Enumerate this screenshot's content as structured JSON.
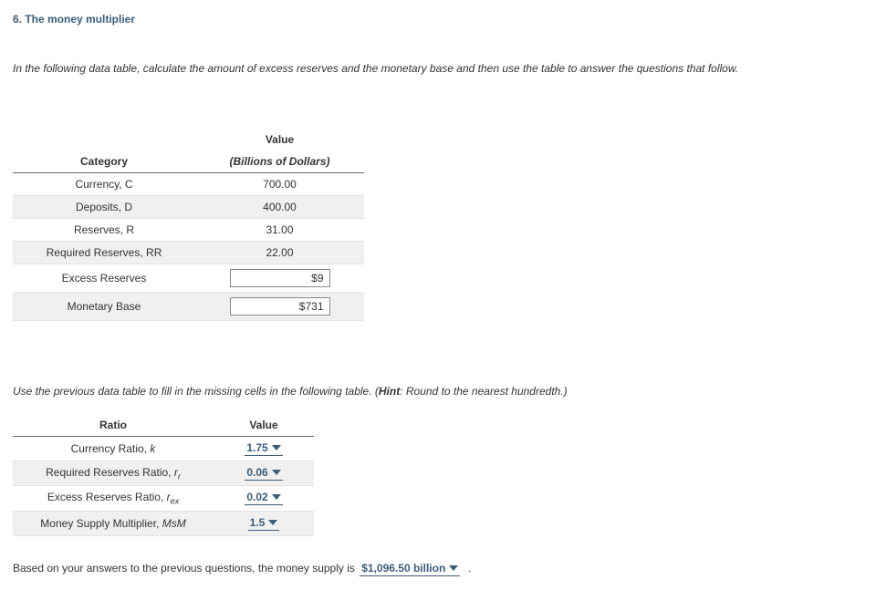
{
  "title": "6. The money multiplier",
  "intro": "In the following data table, calculate the amount of excess reserves and the monetary base and then use the table to answer the questions that follow.",
  "table1": {
    "catHeader": "Category",
    "valHeader": "Value",
    "valSubheader": "(Billions of Dollars)",
    "rows": {
      "currency": {
        "label": "Currency, C",
        "value": "700.00"
      },
      "deposits": {
        "label": "Deposits, D",
        "value": "400.00"
      },
      "reserves": {
        "label": "Reserves, R",
        "value": "31.00"
      },
      "reqres": {
        "label": "Required Reserves, RR",
        "value": "22.00"
      },
      "excess": {
        "label": "Excess Reserves",
        "input": "$9"
      },
      "base": {
        "label": "Monetary Base",
        "input": "$731"
      }
    }
  },
  "intro2": {
    "text": "Use the previous data table to fill in the missing cells in the following table. (",
    "hintLabel": "Hint",
    "hintText": ": Round to the nearest hundredth.)"
  },
  "table2": {
    "ratioHeader": "Ratio",
    "valHeader": "Value",
    "rows": {
      "k": {
        "label": "Currency Ratio, ",
        "sym": "k",
        "value": "1.75"
      },
      "rr": {
        "label": "Required Reserves Ratio, ",
        "sym_r": "r",
        "sym_sub": "r",
        "value": "0.06"
      },
      "rex": {
        "label": "Excess Reserves Ratio, ",
        "sym_r": "r",
        "sym_sub": "ex",
        "value": "0.02"
      },
      "msm": {
        "label": "Money Supply Multiplier, ",
        "sym": "MsM",
        "value": "1.5"
      }
    }
  },
  "final": {
    "pre": "Based on your answers to the previous questions, the money supply is",
    "value": "$1,096.50 billion",
    "post": "."
  }
}
